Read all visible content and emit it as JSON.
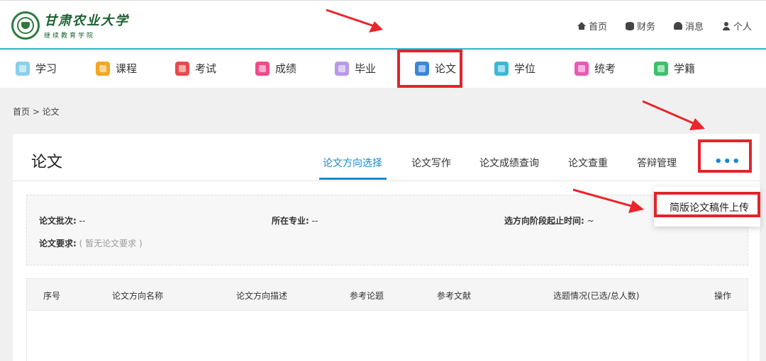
{
  "header": {
    "logo_text": "甘肃农业大学",
    "logo_sub": "继续教育学院",
    "links": [
      {
        "label": "首页",
        "icon": "home-icon"
      },
      {
        "label": "财务",
        "icon": "database-icon"
      },
      {
        "label": "消息",
        "icon": "bell-icon"
      },
      {
        "label": "个人",
        "icon": "user-icon"
      }
    ]
  },
  "nav": {
    "items": [
      {
        "label": "学习",
        "color": "#8ad0ea"
      },
      {
        "label": "课程",
        "color": "#f5a623"
      },
      {
        "label": "考试",
        "color": "#e84b4b"
      },
      {
        "label": "成绩",
        "color": "#f04a8a"
      },
      {
        "label": "毕业",
        "color": "#b89ae8"
      },
      {
        "label": "论文",
        "color": "#3a86d9"
      },
      {
        "label": "学位",
        "color": "#3cb8d6"
      },
      {
        "label": "统考",
        "color": "#e85ab8"
      },
      {
        "label": "学籍",
        "color": "#3cc06a"
      }
    ]
  },
  "breadcrumb": "首页 > 论文",
  "panel": {
    "title": "论文",
    "tabs": [
      "论文方向选择",
      "论文写作",
      "论文成绩查询",
      "论文查重",
      "答辩管理"
    ],
    "more": "•••",
    "dropdown_item": "简版论文稿件上传"
  },
  "info": {
    "batch_label": "论文批次:",
    "batch_value": "--",
    "major_label": "所在专业:",
    "major_value": "--",
    "stage_label": "选方向阶段起止时间:",
    "stage_value": "~",
    "req_label": "论文要求:",
    "req_value": "( 暂无论文要求 )"
  },
  "table": {
    "headers": [
      "序号",
      "论文方向名称",
      "论文方向描述",
      "参考论题",
      "参考文献",
      "选题情况(已选/总人数)",
      "操作"
    ]
  },
  "colors": {
    "accent": "#1e88c7",
    "highlight": "#e0252b",
    "header_border": "#35b5c8"
  }
}
